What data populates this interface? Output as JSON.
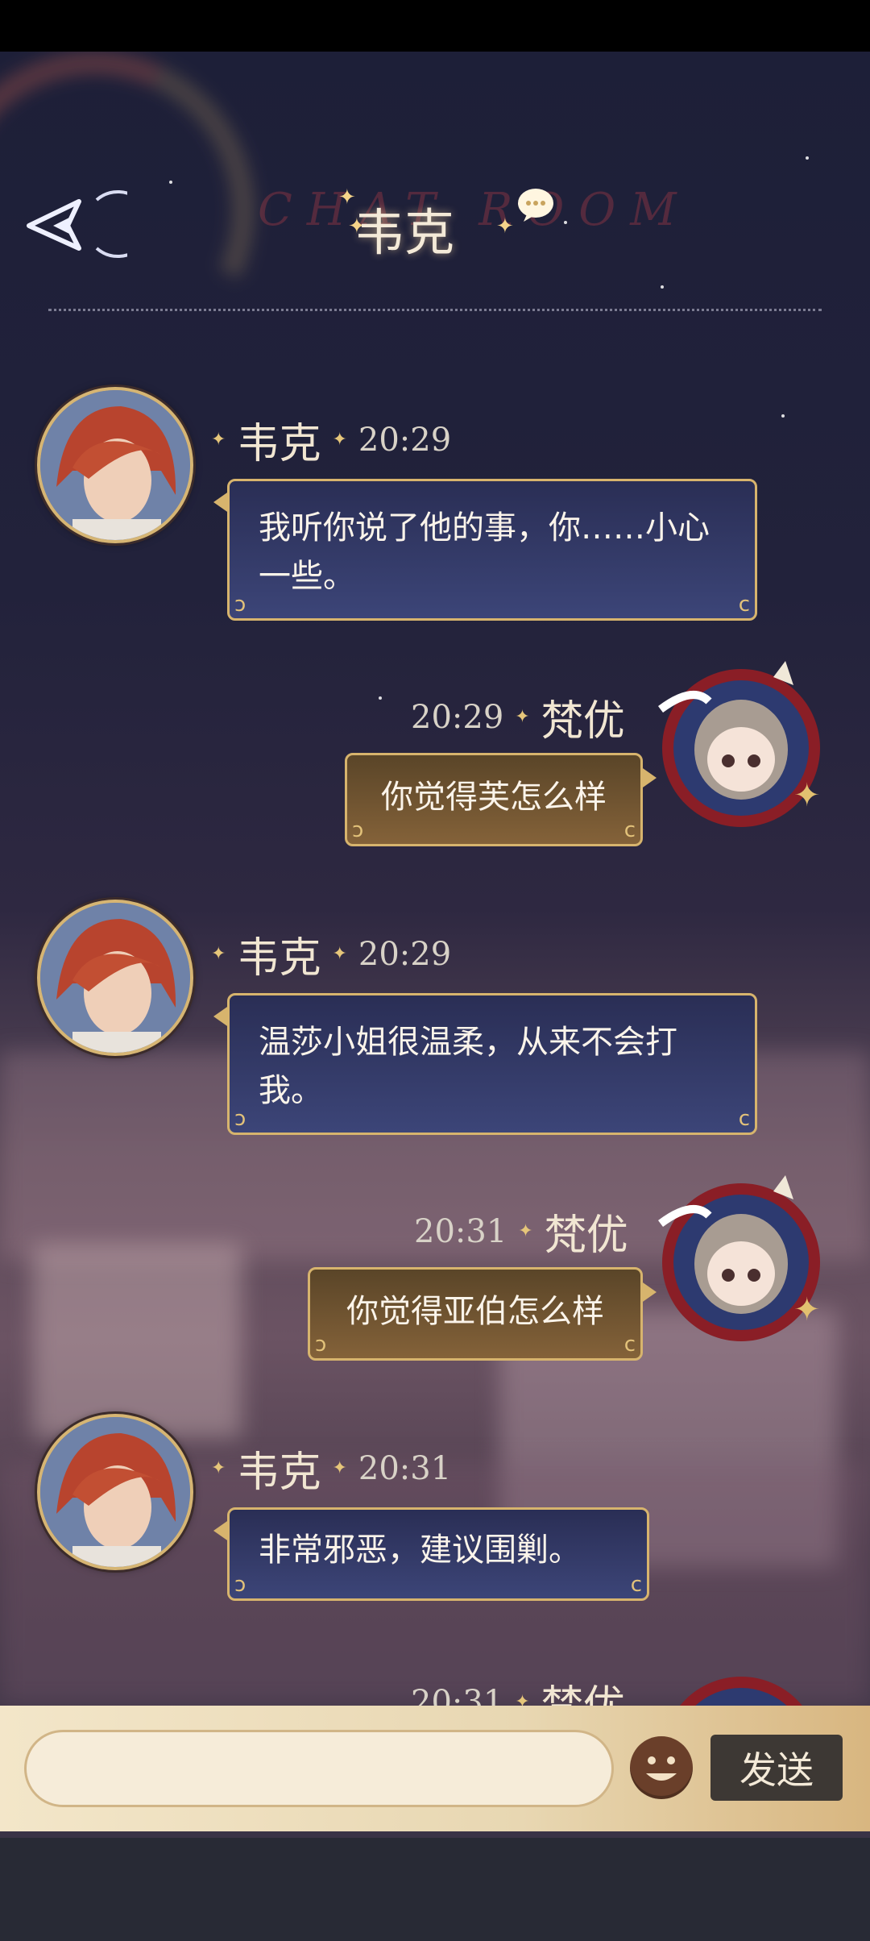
{
  "header": {
    "title": "韦克",
    "watermark": "CHAT ROOM"
  },
  "messages": [
    {
      "sender": "韦克",
      "time": "20:29",
      "text": "我听你说了他的事，你……小心一些。",
      "side": "left"
    },
    {
      "sender": "梵优",
      "time": "20:29",
      "text": "你觉得芙怎么样",
      "side": "right"
    },
    {
      "sender": "韦克",
      "time": "20:29",
      "text": "温莎小姐很温柔，从来不会打我。",
      "side": "left"
    },
    {
      "sender": "梵优",
      "time": "20:31",
      "text": "你觉得亚伯怎么样",
      "side": "right"
    },
    {
      "sender": "韦克",
      "time": "20:31",
      "text": "非常邪恶，建议围剿。",
      "side": "left"
    },
    {
      "sender": "梵优",
      "time": "20:31",
      "text": "",
      "side": "right"
    }
  ],
  "input": {
    "value": "",
    "send_label": "发送"
  },
  "icons": {
    "back": "back-arrow-icon",
    "chat": "chat-bubble-icon",
    "emoji": "emoji-icon"
  },
  "colors": {
    "npc_bubble": "#2f3563",
    "my_bubble": "#6b5030",
    "gold_border": "#d7b46d",
    "send_button": "#3d3834"
  }
}
